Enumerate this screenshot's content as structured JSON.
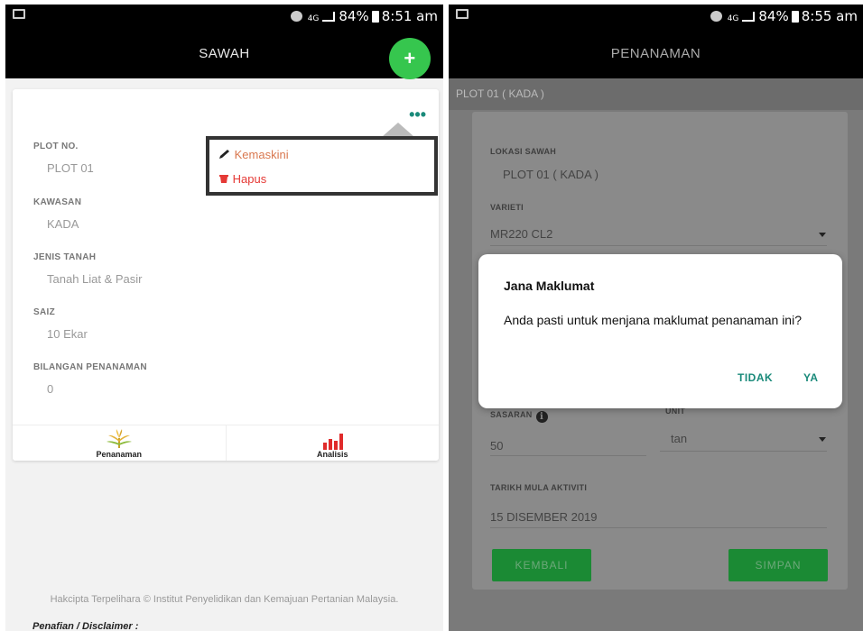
{
  "left": {
    "status": {
      "battery": "84%",
      "time": "8:51 am",
      "network": "4G"
    },
    "title": "SAWAH",
    "fab": "+",
    "card": {
      "more": "•••",
      "fields": [
        {
          "label": "PLOT NO.",
          "value": "PLOT 01"
        },
        {
          "label": "KAWASAN",
          "value": "KADA"
        },
        {
          "label": "JENIS TANAH",
          "value": "Tanah Liat & Pasir"
        },
        {
          "label": "SAIZ",
          "value": "10 Ekar"
        },
        {
          "label": "BILANGAN PENANAMAN",
          "value": "0"
        }
      ],
      "tabs": [
        {
          "label": "Penanaman",
          "icon": "rice-plant-icon"
        },
        {
          "label": "Analisis",
          "icon": "bar-chart-icon"
        }
      ]
    },
    "menu": [
      {
        "label": "Kemaskini",
        "icon": "pencil-icon",
        "color": "#d9784f"
      },
      {
        "label": "Hapus",
        "icon": "trash-icon",
        "color": "#e53935"
      }
    ],
    "footer": "Hakcipta Terpelihara © Institut Penyelidikan dan Kemajuan Pertanian Malaysia.",
    "disclaimer": "Penafian / Disclaimer :"
  },
  "right": {
    "status": {
      "battery": "84%",
      "time": "8:55 am",
      "network": "4G"
    },
    "title": "PENANAMAN",
    "subtitle": "PLOT 01 ( KADA )",
    "form": {
      "lokasi_label": "LOKASI SAWAH",
      "lokasi_value": "PLOT 01 ( KADA )",
      "varieti_label": "VARIETI",
      "varieti_value": "MR220 CL2",
      "sasaran_label": "SASARAN",
      "sasaran_value": "50",
      "unit_label": "UNIT",
      "unit_value": "tan",
      "tarikh_label": "TARIKH MULA AKTIVITI",
      "tarikh_value": "15 DISEMBER 2019"
    },
    "buttons": {
      "back": "KEMBALI",
      "save": "SIMPAN"
    },
    "dialog": {
      "title": "Jana Maklumat",
      "message": "Anda pasti untuk menjana maklumat penanaman ini?",
      "no": "TIDAK",
      "yes": "YA"
    }
  },
  "colors": {
    "accent_green": "#36c64e",
    "teal": "#1a8a7a",
    "appbar": "#000000"
  }
}
